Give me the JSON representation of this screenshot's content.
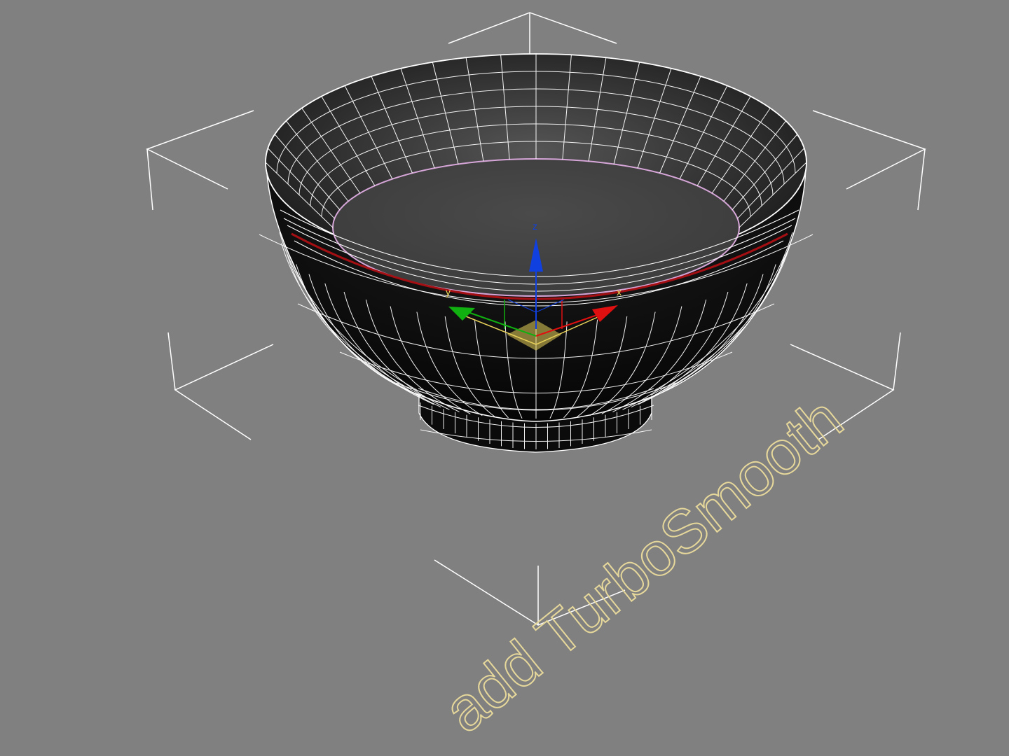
{
  "viewport": {
    "background": "#808080",
    "wire_color": "#ffffff",
    "bracket_color": "#ffffff",
    "selection_ring_color": "#a30f13",
    "inner_ring_color": "#d7a6d9"
  },
  "gizmo": {
    "x_label": "x",
    "y_label": "y",
    "z_label": "z",
    "x_color": "#e01010",
    "y_color": "#10b010",
    "z_color": "#1040e0",
    "plane_color": "#e8d25a"
  },
  "annotation": {
    "text": "add TurboSmooth",
    "color": "#e6d79a"
  }
}
